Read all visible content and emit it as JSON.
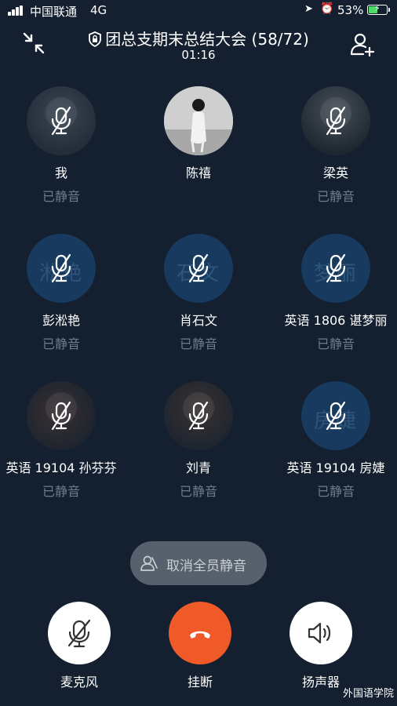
{
  "status_bar": {
    "carrier": "中国联通",
    "network": "4G",
    "battery_percent": "53%",
    "battery_level": 0.53,
    "icons": [
      "signal-bars-icon",
      "location-arrow-icon",
      "alarm-clock-icon",
      "battery-charging-icon"
    ]
  },
  "header": {
    "title": "团总支期末总结大会 (58/72)",
    "timer": "01:16",
    "icons": [
      "shrink-window-icon",
      "lock-shield-icon",
      "add-member-icon"
    ]
  },
  "participants": [
    {
      "name": "我",
      "status": "已静音",
      "muted": true,
      "avatar": "photo"
    },
    {
      "name": "陈禧",
      "status": "",
      "muted": false,
      "avatar": "photo"
    },
    {
      "name": "梁英",
      "status": "已静音",
      "muted": true,
      "avatar": "photo"
    },
    {
      "name": "彭淞艳",
      "status": "已静音",
      "muted": true,
      "avatar": "text",
      "avatar_text": "淞艳"
    },
    {
      "name": "肖石文",
      "status": "已静音",
      "muted": true,
      "avatar": "text",
      "avatar_text": "石文"
    },
    {
      "name": "英语 1806 谌梦丽",
      "status": "已静音",
      "muted": true,
      "avatar": "text",
      "avatar_text": "梦丽"
    },
    {
      "name": "英语 19104 孙芬芬",
      "status": "已静音",
      "muted": true,
      "avatar": "photo"
    },
    {
      "name": "刘青",
      "status": "已静音",
      "muted": true,
      "avatar": "photo"
    },
    {
      "name": "英语 19104 房婕",
      "status": "已静音",
      "muted": true,
      "avatar": "text",
      "avatar_text": "房婕"
    }
  ],
  "actions": {
    "unmute_all": "取消全员静音",
    "microphone": "麦克风",
    "hangup": "挂断",
    "speaker": "扬声器"
  },
  "watermark": "外国语学院",
  "colors": {
    "background": "#142030",
    "hangup": "#f05a28",
    "muted_text": "#6f7b88",
    "text_avatar": "#173a5e"
  }
}
